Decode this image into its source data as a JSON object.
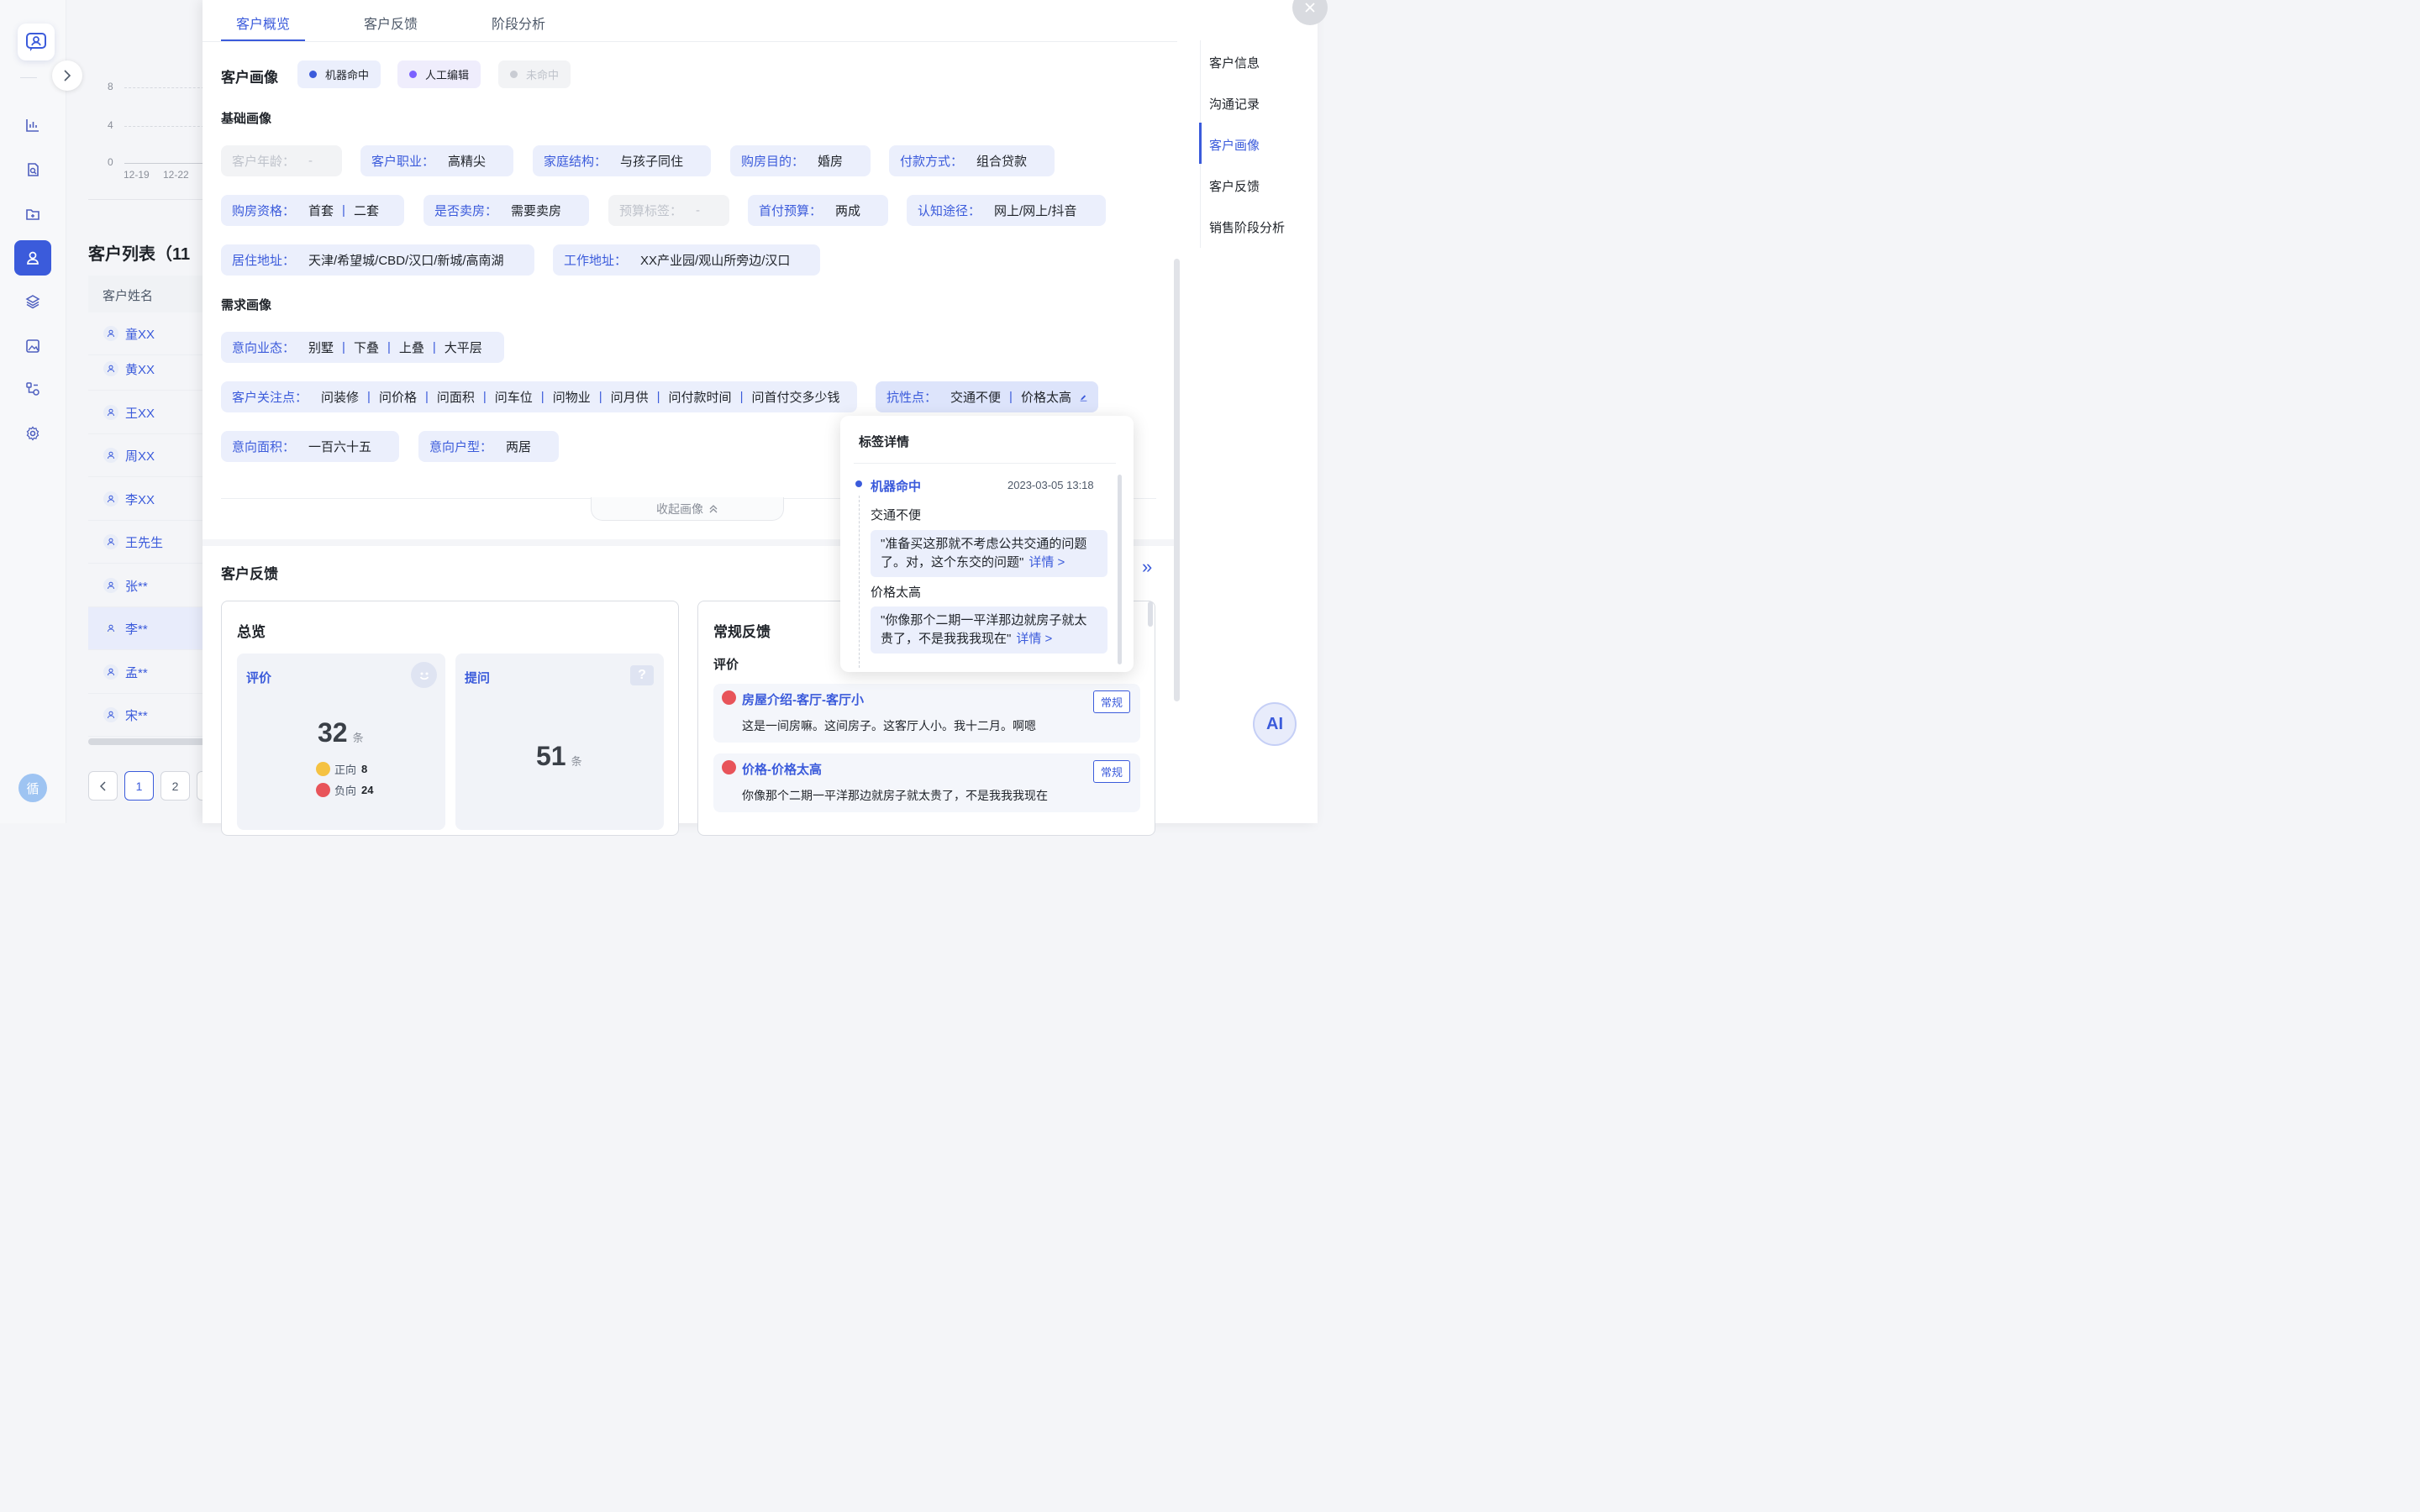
{
  "nav": {
    "avatar_text": "循",
    "items": [
      "chart-icon",
      "search-doc-icon",
      "folder-icon",
      "user-icon",
      "layers-icon",
      "image-icon",
      "flow-icon",
      "gear-icon"
    ]
  },
  "bg": {
    "y_ticks": [
      "8",
      "4",
      "0"
    ],
    "x_ticks": [
      "12-19",
      "12-22"
    ],
    "list_title": "客户列表（11",
    "list_header": "客户姓名",
    "customers": [
      "童XX",
      "黄XX",
      "王XX",
      "周XX",
      "李XX",
      "王先生",
      "张**",
      "李**",
      "孟**",
      "宋**"
    ],
    "pages": [
      "1",
      "2"
    ]
  },
  "tabs": [
    "客户概览",
    "客户反馈",
    "阶段分析"
  ],
  "portrait": {
    "title": "客户画像",
    "legend": [
      {
        "label": "机器命中",
        "color": "#3b5bdb"
      },
      {
        "label": "人工编辑",
        "color": "#7b61ff"
      },
      {
        "label": "未命中",
        "color": "#c9ccd3"
      }
    ],
    "basic_title": "基础画像",
    "basic": [
      {
        "k": "客户年龄：",
        "v": "-"
      },
      {
        "k": "客户职业：",
        "v": "高精尖"
      },
      {
        "k": "家庭结构：",
        "v": "与孩子同住"
      },
      {
        "k": "购房目的：",
        "v": "婚房"
      },
      {
        "k": "付款方式：",
        "v": "组合贷款"
      },
      {
        "k": "购房资格：",
        "v1": "首套",
        "v2": "二套"
      },
      {
        "k": "是否卖房：",
        "v": "需要卖房"
      },
      {
        "k": "预算标签：",
        "v": "-"
      },
      {
        "k": "首付预算：",
        "v": "两成"
      },
      {
        "k": "认知途径：",
        "v": "网上/网上/抖音"
      },
      {
        "k": "居住地址：",
        "v": "天津/希望城/CBD/汉口/新城/高南湖"
      },
      {
        "k": "工作地址：",
        "v": "XX产业园/观山所旁边/汉口"
      }
    ],
    "demand_title": "需求画像",
    "intent_type": {
      "k": "意向业态：",
      "vals": [
        "别墅",
        "下叠",
        "上叠",
        "大平层"
      ]
    },
    "focus": {
      "k": "客户关注点：",
      "vals": [
        "问装修",
        "问价格",
        "问面积",
        "问车位",
        "问物业",
        "问月供",
        "问付款时间",
        "问首付交多少钱"
      ]
    },
    "resist": {
      "k": "抗性点：",
      "vals": [
        "交通不便",
        "价格太高"
      ]
    },
    "area": {
      "k": "意向面积：",
      "v": "一百六十五"
    },
    "layout": {
      "k": "意向户型：",
      "v": "两居"
    },
    "collapse_label": "收起画像"
  },
  "feedback": {
    "title": "客户反馈",
    "overview": {
      "title": "总览",
      "eval_label": "评价",
      "eval_count": "32",
      "unit": "条",
      "positive_label": "正向",
      "positive_count": "8",
      "negative_label": "负向",
      "negative_count": "24",
      "ask_label": "提问",
      "ask_count": "51"
    },
    "regular": {
      "title": "常规反馈",
      "eval_label": "评价",
      "items": [
        {
          "title": "房屋介绍-客厅-客厅小",
          "desc": "这是一间房嘛。这间房子。这客厅人小。我十二月。啊嗯",
          "badge": "常规"
        },
        {
          "title": "价格-价格太高",
          "desc": "你像那个二期一平洋那边就房子就太贵了，不是我我我现在",
          "badge": "常规"
        }
      ]
    }
  },
  "anchors": [
    "客户信息",
    "沟通记录",
    "客户画像",
    "客户反馈",
    "销售阶段分析"
  ],
  "popover": {
    "title": "标签详情",
    "source": "机器命中",
    "time": "2023-03-05 13:18",
    "entries": [
      {
        "word": "交通不便",
        "quote1": "\"准备买这那就不考虑公共交通的问题",
        "quote2": "了。对，这个东交的问题\"",
        "link": "详情 >"
      },
      {
        "word": "价格太高",
        "quote1": "\"你像那个二期一平洋那边就房子就太",
        "quote2": "贵了，不是我我我现在\"",
        "link": "详情 >"
      }
    ]
  },
  "ai_label": "AI"
}
